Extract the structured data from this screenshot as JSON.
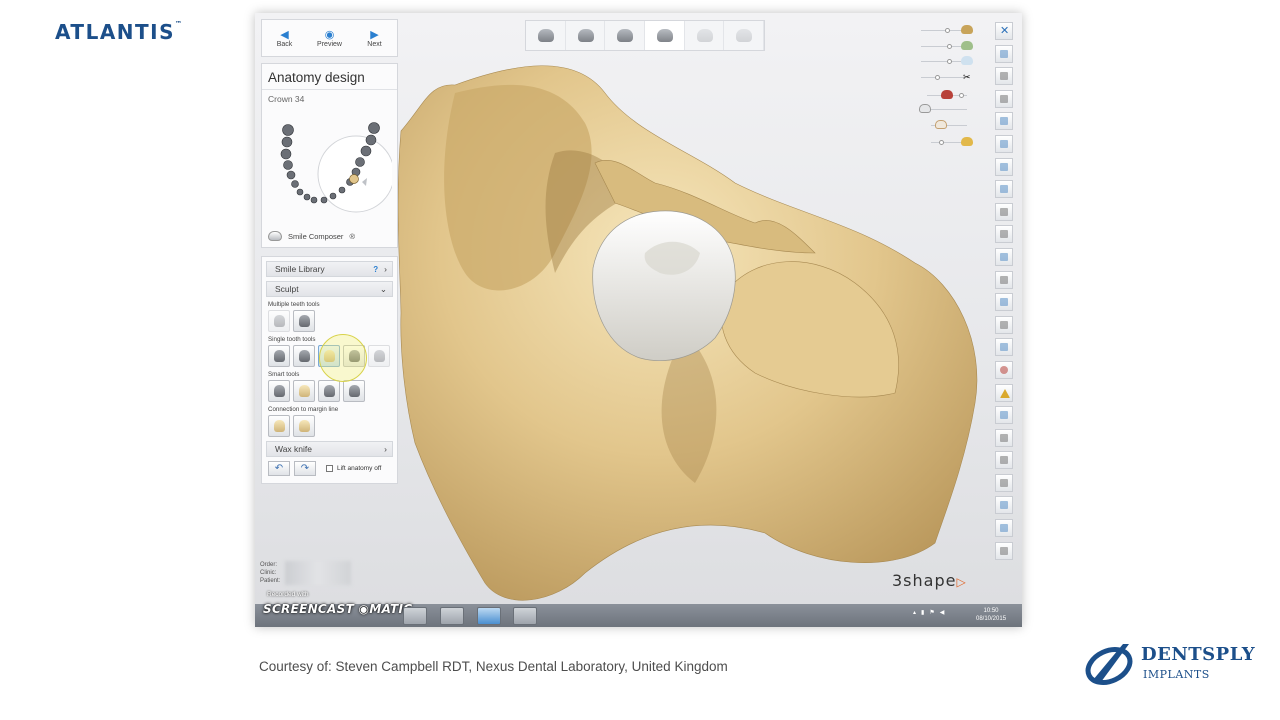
{
  "brand": {
    "left_logo": "ATLANTIS",
    "left_logo_mark": "™",
    "right_logo_word": "DENTSPLY",
    "right_logo_sub": "IMPLANTS"
  },
  "navigation": {
    "back": "Back",
    "preview": "Preview",
    "next": "Next"
  },
  "anatomy_panel": {
    "title": "Anatomy design",
    "subtitle": "Crown 34",
    "smile_composer": "Smile Composer",
    "smile_composer_marker": "®"
  },
  "tools_panel": {
    "smile_library": "Smile Library",
    "help": "?",
    "sculpt": "Sculpt",
    "groups": {
      "multiple": "Multiple teeth tools",
      "single": "Single tooth tools",
      "smart": "Smart tools",
      "connection": "Connection to margin line"
    },
    "wax_knife": "Wax knife",
    "lift_anatomy": "Lift anatomy off"
  },
  "patient_info": {
    "order": "Order:",
    "clinic": "Clinic:",
    "patient": "Patient:"
  },
  "app_logo": {
    "text": "3shape",
    "mark": "▷"
  },
  "recorder": {
    "recorded_with": "Recorded with",
    "name": "SCREENCAST",
    "name_suffix": "MATIC"
  },
  "taskbar": {
    "time": "10:50",
    "date": "08/10/2015"
  },
  "courtesy": "Courtesy of: Steven Campbell RDT, Nexus Dental Laboratory, United Kingdom",
  "colors": {
    "brand_blue": "#1c4f8a",
    "accent_blue": "#2a7fd0",
    "model_gold": "#e2c68c",
    "crown_white": "#f2f1ec",
    "shape_orange": "#e0662a"
  }
}
